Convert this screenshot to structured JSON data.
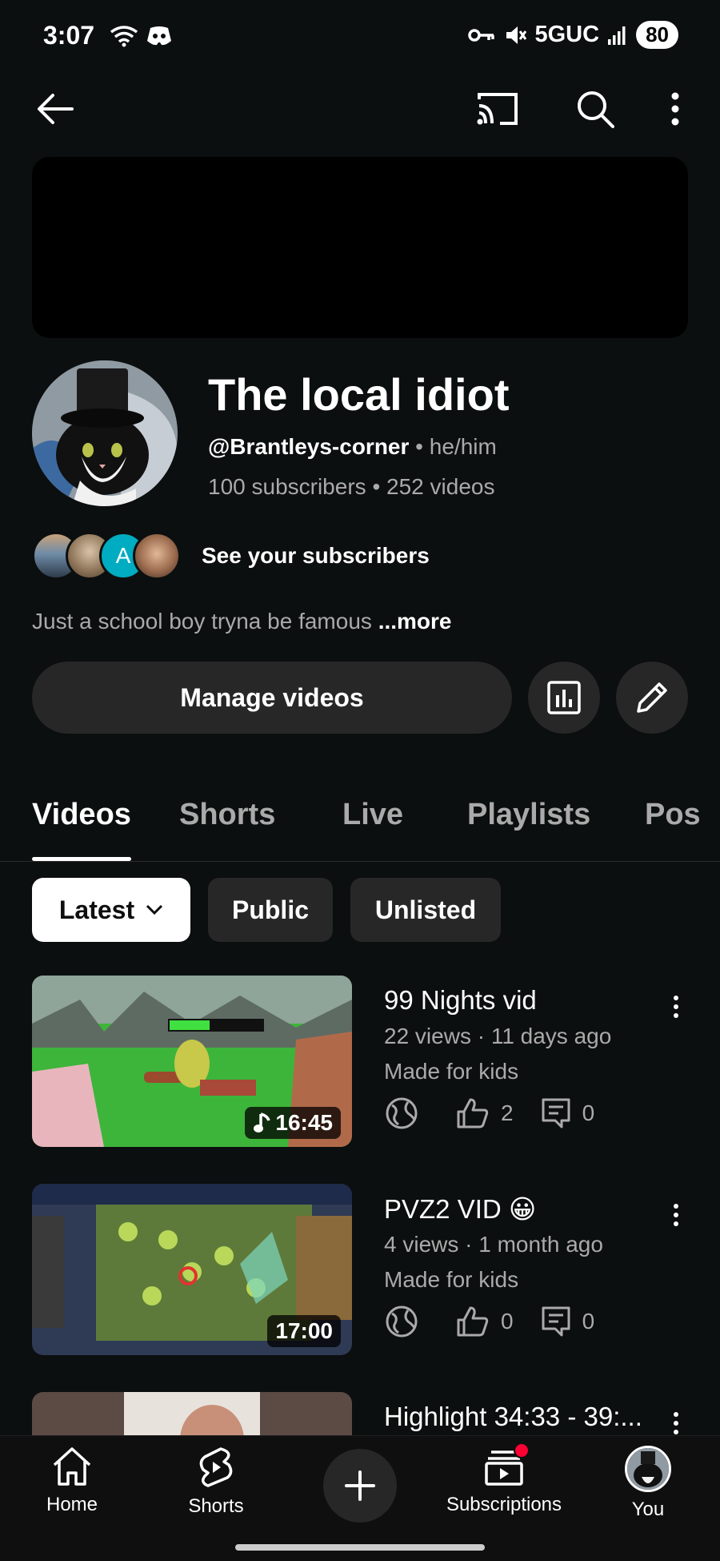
{
  "status_bar": {
    "time": "3:07",
    "network": "5GUC",
    "battery": "80"
  },
  "channel": {
    "name": "The local idiot",
    "handle": "@Brantleys-corner",
    "pronouns": "he/him",
    "subscribers": "100 subscribers",
    "videos": "252 videos",
    "see_subscribers": "See your subscribers",
    "subscriber_avatar_letter": "A",
    "description": "Just a school boy tryna be famous",
    "more": "...more",
    "separator": "•"
  },
  "actions": {
    "manage_videos": "Manage videos"
  },
  "tabs": [
    "Videos",
    "Shorts",
    "Live",
    "Playlists",
    "Pos"
  ],
  "filters": {
    "latest": "Latest",
    "public": "Public",
    "unlisted": "Unlisted"
  },
  "videos": [
    {
      "title": "99 Nights vid",
      "meta": "22 views · 11 days ago",
      "audience": "Made for kids",
      "likes": "2",
      "comments": "0",
      "duration": "16:45"
    },
    {
      "title": "PVZ2 VID 😀",
      "meta": "4 views · 1 month ago",
      "audience": "Made for kids",
      "likes": "0",
      "comments": "0",
      "duration": "17:00"
    },
    {
      "title": "Highlight 34:33 - 39:..."
    }
  ],
  "bottom_nav": {
    "home": "Home",
    "shorts": "Shorts",
    "subscriptions": "Subscriptions",
    "you": "You"
  },
  "colors": {
    "background": "#0c0f0f",
    "surface": "#272727",
    "secondary_text": "#aaaaaa",
    "notification_dot": "#ff0033"
  }
}
